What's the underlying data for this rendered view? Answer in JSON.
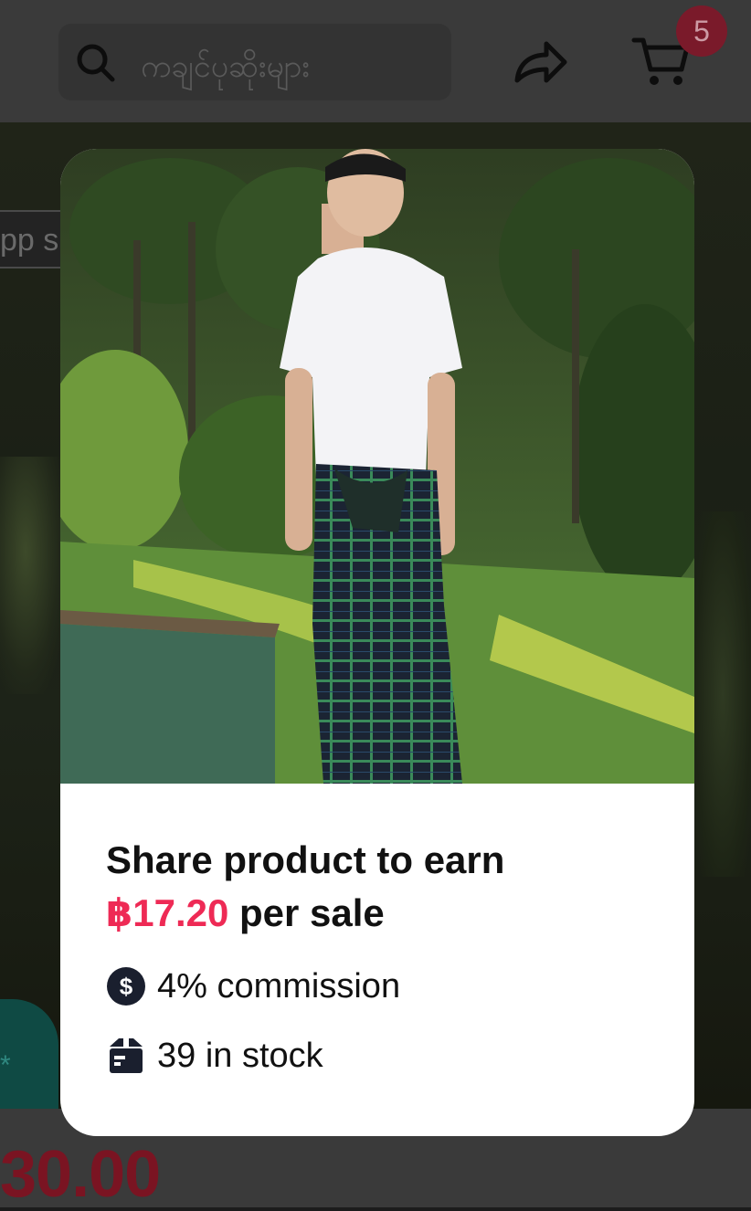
{
  "topbar": {
    "search_placeholder": "ကချင်ပုဆိုးများ",
    "cart_count": "5"
  },
  "background": {
    "tab_text": "pp s",
    "chat_fragment": "*",
    "price_fragment": "30.00"
  },
  "modal": {
    "headline_prefix": "Share product to earn",
    "earn_amount": "฿17.20",
    "headline_suffix": "per sale",
    "commission_text": "4% commission",
    "stock_text": "39 in stock"
  },
  "colors": {
    "accent_red": "#ee2a55",
    "badge_bg": "#7a1a2a"
  },
  "icons": {
    "search": "search-icon",
    "share": "share-arrow-icon",
    "cart": "cart-icon",
    "commission": "dollar-circle-icon",
    "stock": "box-icon"
  }
}
